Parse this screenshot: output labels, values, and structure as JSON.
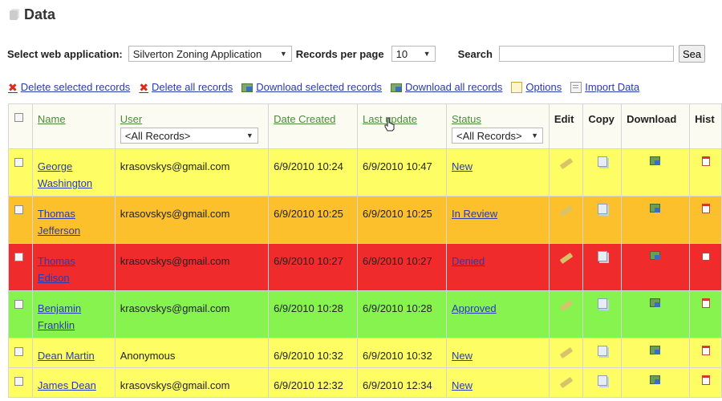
{
  "page": {
    "title": "Data"
  },
  "controls": {
    "web_app_label": "Select web application:",
    "web_app_value": "Silverton Zoning Application",
    "records_label": "Records per page",
    "records_value": "10",
    "search_label": "Search",
    "search_value": "",
    "search_button": "Sea"
  },
  "actions": {
    "delete_selected": "Delete selected records",
    "delete_all": "Delete all records",
    "download_selected": "Download selected records",
    "download_all": "Download all records",
    "options": "Options",
    "import": "Import Data"
  },
  "table": {
    "headers": {
      "name": "Name",
      "user": "User",
      "user_filter": "<All Records>",
      "date_created": "Date Created",
      "last_update": "Last update",
      "status": "Status",
      "status_filter": "<All Records>",
      "edit": "Edit",
      "copy": "Copy",
      "download": "Download",
      "history": "Hist"
    },
    "rows": [
      {
        "name_l1": "George",
        "name_l2": "Washington",
        "user": "krasovskys@gmail.com",
        "created": "6/9/2010 10:24",
        "updated": "6/9/2010 10:47",
        "status": "New",
        "color": "#fefd64"
      },
      {
        "name_l1": "Thomas",
        "name_l2": "Jefferson",
        "user": "krasovskys@gmail.com",
        "created": "6/9/2010 10:25",
        "updated": "6/9/2010 10:25",
        "status": "In Review",
        "color": "#fbc02b"
      },
      {
        "name_l1": "Thomas",
        "name_l2": "Edison",
        "user": "krasovskys@gmail.com",
        "created": "6/9/2010 10:27",
        "updated": "6/9/2010 10:27",
        "status": "Denied",
        "color": "#f02b2b"
      },
      {
        "name_l1": "Benjamin",
        "name_l2": "Franklin",
        "user": "krasovskys@gmail.com",
        "created": "6/9/2010 10:28",
        "updated": "6/9/2010 10:28",
        "status": "Approved",
        "color": "#87f34f"
      },
      {
        "name_l1": "Dean Martin",
        "name_l2": "",
        "user": "Anonymous",
        "created": "6/9/2010 10:32",
        "updated": "6/9/2010 10:32",
        "status": "New",
        "color": "#fefd64"
      },
      {
        "name_l1": "James Dean",
        "name_l2": "",
        "user": "krasovskys@gmail.com",
        "created": "6/9/2010 12:32",
        "updated": "6/9/2010 12:34",
        "status": "New",
        "color": "#fefd64"
      }
    ]
  }
}
